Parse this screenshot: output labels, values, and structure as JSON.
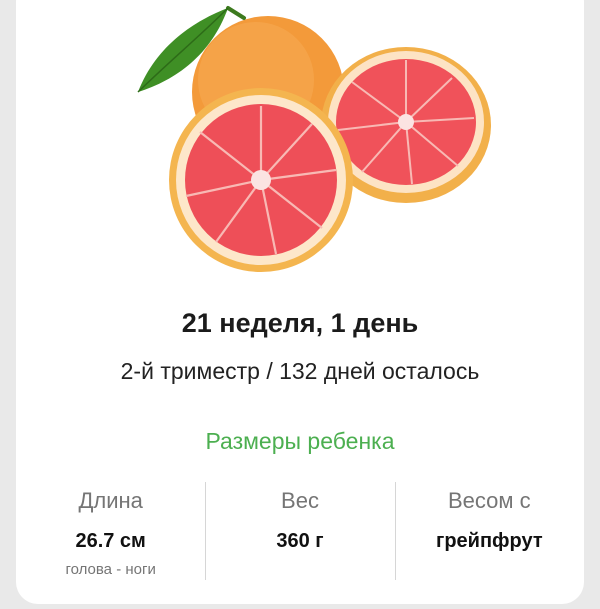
{
  "week": {
    "title": "21 неделя, 1 день",
    "subtitle": "2-й триместр / 132 дней осталось",
    "fruit_icon": "grapefruit-image"
  },
  "baby_size": {
    "section_title": "Размеры ребенка",
    "length": {
      "label": "Длина",
      "value": "26.7 см",
      "note": "голова - ноги"
    },
    "weight": {
      "label": "Вес",
      "value": "360 г"
    },
    "compare": {
      "label": "Весом с",
      "value": "грейпфрут"
    }
  },
  "colors": {
    "accent": "#4caf50",
    "peel": "#f5a623",
    "flesh": "#f0525a"
  }
}
